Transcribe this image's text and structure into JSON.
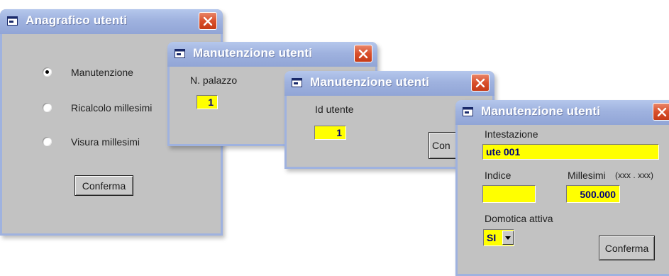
{
  "windows": {
    "anagrafico": {
      "title": "Anagrafico utenti",
      "options": [
        {
          "label": "Manutenzione",
          "checked": true
        },
        {
          "label": "Ricalcolo millesimi",
          "checked": false
        },
        {
          "label": "Visura millesimi",
          "checked": false
        }
      ],
      "confirm_label": "Conferma"
    },
    "manutenzione_palazzo": {
      "title": "Manutenzione utenti",
      "field_label": "N. palazzo",
      "field_value": "1"
    },
    "manutenzione_id": {
      "title": "Manutenzione utenti",
      "field_label": "Id utente",
      "field_value": "1",
      "confirm_label_partial": "Con"
    },
    "manutenzione_dettaglio": {
      "title": "Manutenzione utenti",
      "intestazione_label": "Intestazione",
      "intestazione_value": "ute 001",
      "indice_label": "Indice",
      "indice_value": "",
      "millesimi_label": "Millesimi",
      "millesimi_format": "(xxx . xxx)",
      "millesimi_value": "500.000",
      "domotica_label": "Domotica attiva",
      "domotica_value": "SI",
      "confirm_label": "Conferma"
    }
  },
  "colors": {
    "titlebar": "#9fb2df",
    "window_body": "#c2c2c2",
    "field_bg": "#ffff00",
    "field_text": "#00007a",
    "close_button": "#d9502c"
  },
  "icons": {
    "window": "window-icon",
    "close": "close-icon",
    "dropdown": "chevron-down-icon"
  }
}
